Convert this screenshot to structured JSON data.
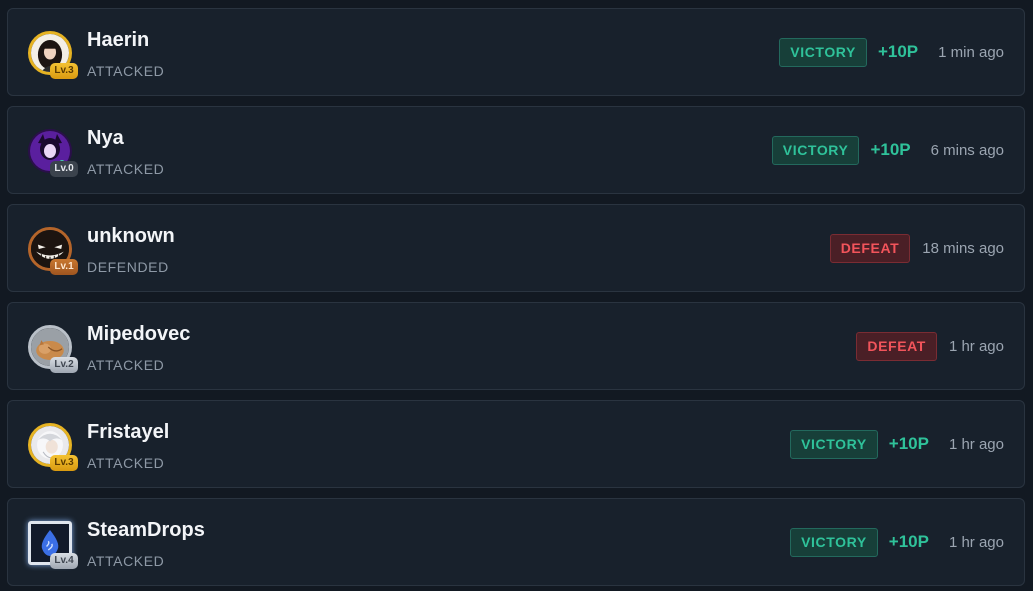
{
  "colors": {
    "victory": "#2fc29a",
    "defeat": "#f2545b",
    "background": "#121922",
    "card": "#18212c"
  },
  "entries": [
    {
      "name": "Haerin",
      "action": "ATTACKED",
      "level": "Lv.3",
      "result": "VICTORY",
      "points": "+10P",
      "time": "1 min ago",
      "avatar_icon": "girl-portrait-icon"
    },
    {
      "name": "Nya",
      "action": "ATTACKED",
      "level": "Lv.0",
      "result": "VICTORY",
      "points": "+10P",
      "time": "6 mins ago",
      "avatar_icon": "purple-character-icon"
    },
    {
      "name": "unknown",
      "action": "DEFENDED",
      "level": "Lv.1",
      "result": "DEFEAT",
      "points": "",
      "time": "18 mins ago",
      "avatar_icon": "grinning-face-icon"
    },
    {
      "name": "Mipedovec",
      "action": "ATTACKED",
      "level": "Lv.2",
      "result": "DEFEAT",
      "points": "",
      "time": "1 hr ago",
      "avatar_icon": "cat-icon"
    },
    {
      "name": "Fristayel",
      "action": "ATTACKED",
      "level": "Lv.3",
      "result": "VICTORY",
      "points": "+10P",
      "time": "1 hr ago",
      "avatar_icon": "white-hair-character-icon"
    },
    {
      "name": "SteamDrops",
      "action": "ATTACKED",
      "level": "Lv.4",
      "result": "VICTORY",
      "points": "+10P",
      "time": "1 hr ago",
      "avatar_icon": "water-drop-icon"
    }
  ]
}
